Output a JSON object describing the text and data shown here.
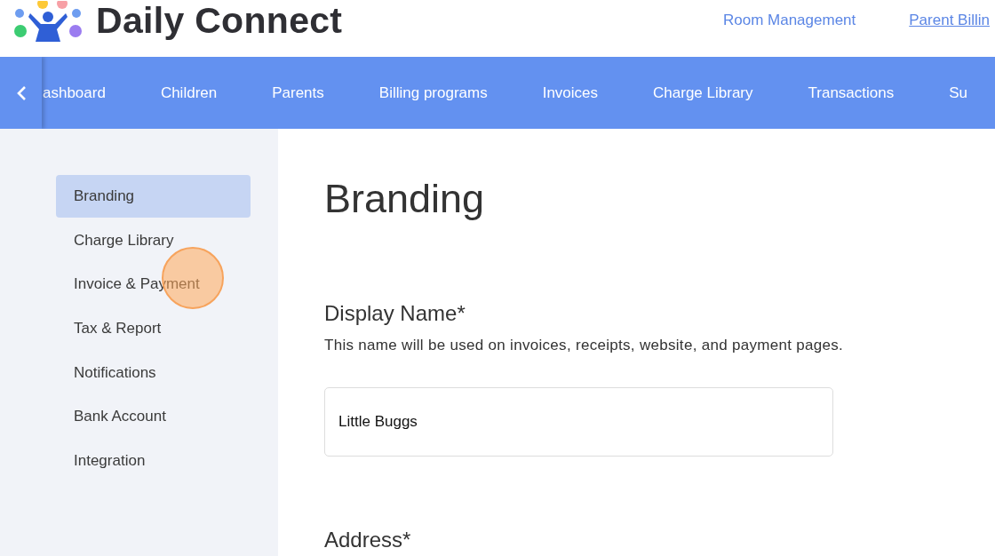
{
  "header": {
    "title": "Daily Connect",
    "links": [
      {
        "label": "Room Management",
        "underlined": false
      },
      {
        "label": "Parent Billin",
        "underlined": true
      }
    ]
  },
  "nav": {
    "tabs": [
      {
        "label": "ashboard"
      },
      {
        "label": "Children"
      },
      {
        "label": "Parents"
      },
      {
        "label": "Billing programs"
      },
      {
        "label": "Invoices"
      },
      {
        "label": "Charge Library"
      },
      {
        "label": "Transactions"
      },
      {
        "label": "Su"
      }
    ]
  },
  "sidebar": {
    "items": [
      {
        "label": "Branding",
        "selected": true
      },
      {
        "label": "Charge Library",
        "selected": false
      },
      {
        "label": "Invoice & Payment",
        "selected": false
      },
      {
        "label": "Tax & Report",
        "selected": false
      },
      {
        "label": "Notifications",
        "selected": false
      },
      {
        "label": "Bank Account",
        "selected": false
      },
      {
        "label": "Integration",
        "selected": false
      }
    ]
  },
  "main": {
    "heading": "Branding",
    "sections": [
      {
        "title": "Display Name*",
        "description": "This name will be used on invoices, receipts, website, and payment pages.",
        "value": "Little Buggs"
      },
      {
        "title": "Address*"
      }
    ]
  }
}
